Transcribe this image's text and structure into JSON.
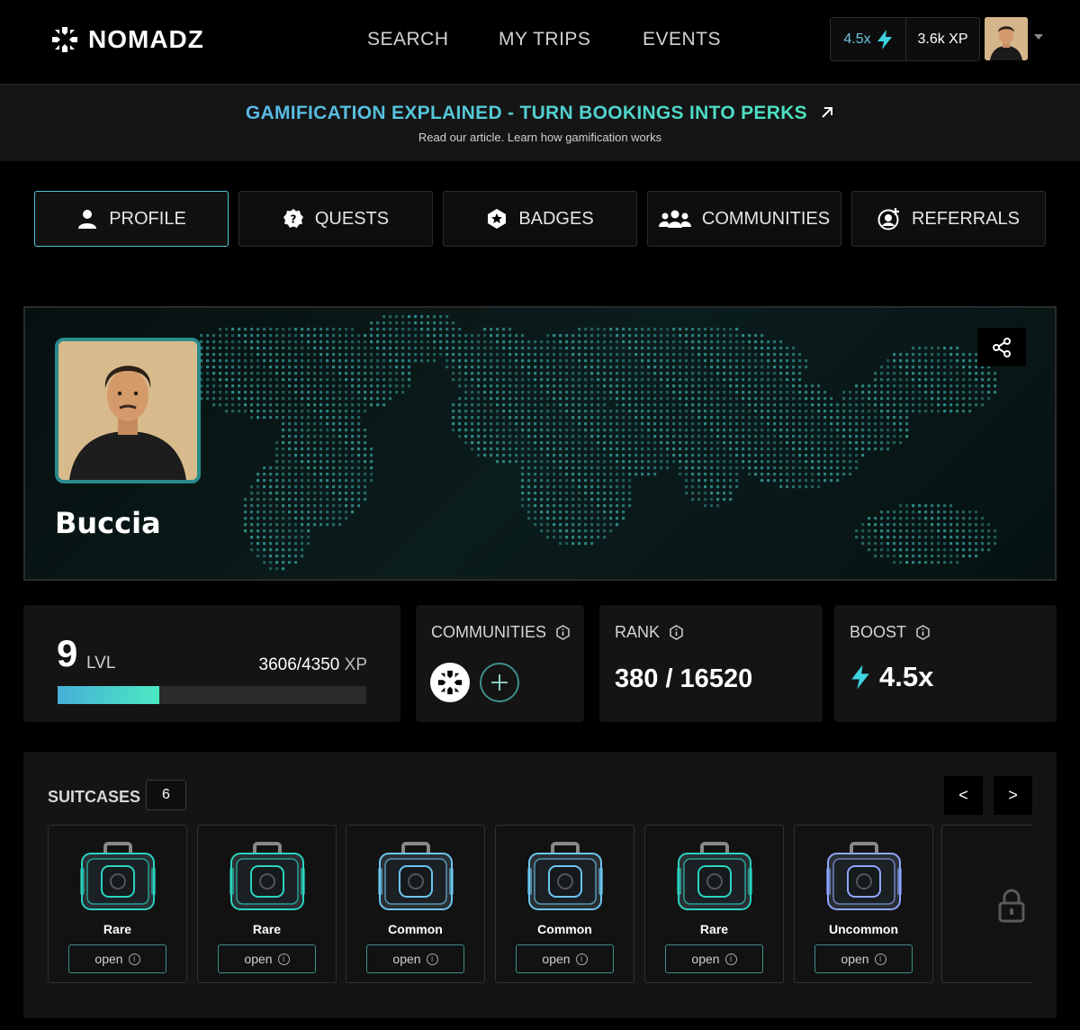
{
  "brand": {
    "name": "NOMADZ"
  },
  "nav": {
    "links": [
      "SEARCH",
      "MY TRIPS",
      "EVENTS"
    ]
  },
  "user_stats": {
    "boost": "4.5x",
    "xp": "3.6k XP"
  },
  "banner": {
    "title": "GAMIFICATION EXPLAINED - TURN BOOKINGS INTO PERKS",
    "subtitle": "Read our article. Learn how gamification works"
  },
  "tabs": [
    {
      "label": "PROFILE",
      "icon": "user-icon",
      "active": true
    },
    {
      "label": "QUESTS",
      "icon": "question-badge-icon",
      "active": false
    },
    {
      "label": "BADGES",
      "icon": "star-badge-icon",
      "active": false
    },
    {
      "label": "COMMUNITIES",
      "icon": "group-icon",
      "active": false
    },
    {
      "label": "REFERRALS",
      "icon": "add-user-icon",
      "active": false
    }
  ],
  "profile": {
    "name": "Buccia"
  },
  "level": {
    "value": "9",
    "label": "LVL",
    "xp_current": "3606/4350",
    "xp_unit": "XP",
    "progress": 0.33
  },
  "communities": {
    "title": "COMMUNITIES"
  },
  "rank": {
    "title": "RANK",
    "value": "380 / 16520"
  },
  "boost": {
    "title": "BOOST",
    "value": "4.5x"
  },
  "suitcases": {
    "title": "SUITCASES",
    "count": "6",
    "prev_label": "<",
    "next_label": ">",
    "items": [
      {
        "rarity": "Rare",
        "action": "open",
        "color": "#2bd3c0"
      },
      {
        "rarity": "Rare",
        "action": "open",
        "color": "#2bd3c0"
      },
      {
        "rarity": "Common",
        "action": "open",
        "color": "#6cc6f0"
      },
      {
        "rarity": "Common",
        "action": "open",
        "color": "#6cc6f0"
      },
      {
        "rarity": "Rare",
        "action": "open",
        "color": "#2bd3c0"
      },
      {
        "rarity": "Uncommon",
        "action": "open",
        "color": "#8fa6ff"
      }
    ]
  }
}
